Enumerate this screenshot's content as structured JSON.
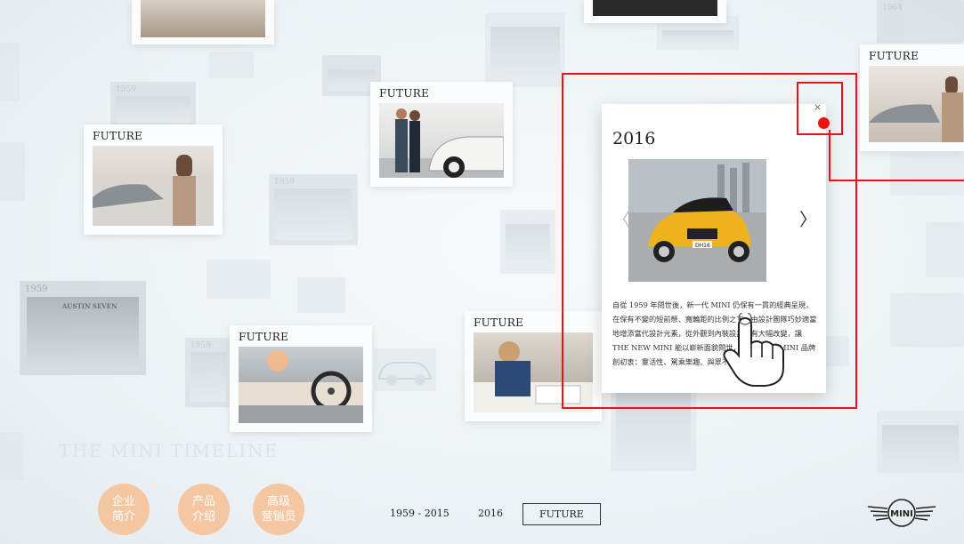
{
  "cards": {
    "future_label": "FUTURE"
  },
  "background_years": {
    "y1959": "1959",
    "y1964": "1964",
    "y1959_big": "1959",
    "sign": "AUSTIN SEVEN"
  },
  "detail": {
    "year": "2016",
    "close_symbol": "×",
    "prev_symbol": "〈",
    "next_symbol": "〉",
    "description": "自從 1959 年問世後，新一代 MINI 仍保有一貫的經典呈現，在保有不變的短前懸、寬輪距的比例之下，由設計團隊巧妙適當地增添當代設計元素，從外觀到內裝設計皆有大幅改變，讓 THE NEW MINI 能以嶄新面貌問世，但同時保有 MINI 品牌創初衷：靈活性、駕乘樂趣、與眾不同。",
    "plate": "DH16"
  },
  "headline": "THE MINI TIMELINE",
  "bottom_nav": {
    "buttons": [
      {
        "label": "企业\n简介"
      },
      {
        "label": "产品\n介绍"
      },
      {
        "label": "高级\n营销员"
      }
    ],
    "timeline": [
      {
        "label": "1959 - 2015",
        "active": false
      },
      {
        "label": "2016",
        "active": false
      },
      {
        "label": "FUTURE",
        "active": true
      }
    ],
    "logo_text": "MINI"
  },
  "colors": {
    "accent_button": "#f4c7a2",
    "annotation": "#e11111"
  }
}
